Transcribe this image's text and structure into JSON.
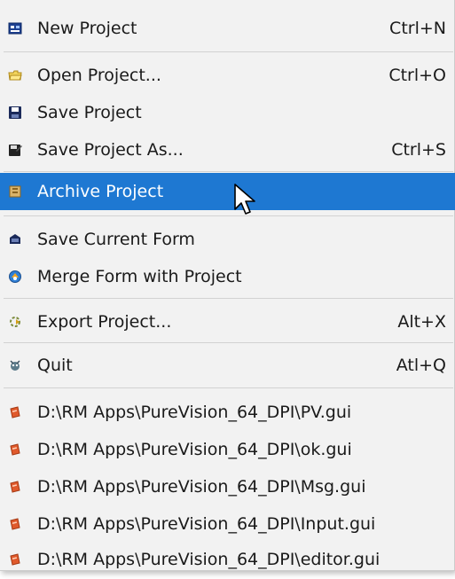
{
  "menu": {
    "items": [
      {
        "label": "New Project",
        "accel": "Ctrl+N",
        "icon": "new-project-icon"
      },
      {
        "label": "Open Project...",
        "accel": "Ctrl+O",
        "icon": "open-folder-icon"
      },
      {
        "label": "Save Project",
        "accel": "",
        "icon": "floppy-disk-icon"
      },
      {
        "label": "Save Project As...",
        "accel": "Ctrl+S",
        "icon": "save-as-icon"
      },
      {
        "label": "Archive Project",
        "accel": "",
        "icon": "archive-icon",
        "highlighted": true
      },
      {
        "label": "Save Current Form",
        "accel": "",
        "icon": "save-form-icon"
      },
      {
        "label": "Merge Form with Project",
        "accel": "",
        "icon": "merge-icon"
      },
      {
        "label": "Export Project...",
        "accel": "Alt+X",
        "icon": "export-icon"
      },
      {
        "label": "Quit",
        "accel": "Atl+Q",
        "icon": "quit-icon"
      }
    ],
    "recent_files": [
      {
        "label": "D:\\RM Apps\\PureVision_64_DPI\\PV.gui",
        "icon": "gui-file-icon"
      },
      {
        "label": "D:\\RM Apps\\PureVision_64_DPI\\ok.gui",
        "icon": "gui-file-icon"
      },
      {
        "label": "D:\\RM Apps\\PureVision_64_DPI\\Msg.gui",
        "icon": "gui-file-icon"
      },
      {
        "label": "D:\\RM Apps\\PureVision_64_DPI\\Input.gui",
        "icon": "gui-file-icon"
      },
      {
        "label": "D:\\RM Apps\\PureVision_64_DPI\\editor.gui",
        "icon": "gui-file-icon"
      }
    ]
  },
  "colors": {
    "highlight": "#1e78d2",
    "menu_background": "#f2f2f2",
    "separator": "#d2d2d2"
  }
}
